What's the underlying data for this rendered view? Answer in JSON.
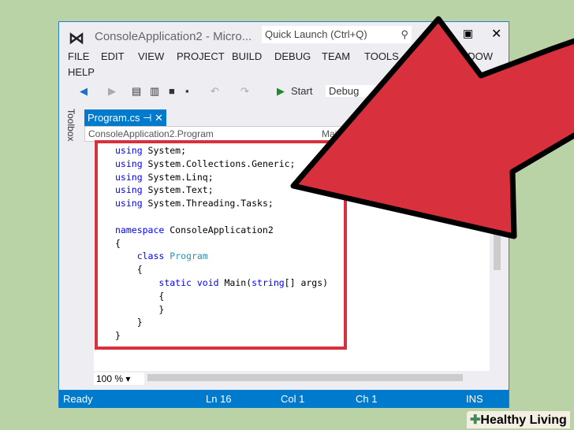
{
  "window": {
    "title": "ConsoleApplication2 - Micro...",
    "quick_launch": "Quick Launch (Ctrl+Q)"
  },
  "menu": [
    "FILE",
    "EDIT",
    "VIEW",
    "PROJECT",
    "BUILD",
    "DEBUG",
    "TEAM",
    "TOOLS",
    "WINDOW",
    "HELP"
  ],
  "toolbar": {
    "start": "Start",
    "config": "Debug"
  },
  "toolbox": "Toolbox",
  "tab": {
    "label": "Program.cs"
  },
  "nav": {
    "class": "ConsoleApplication2.Program",
    "member": "Main"
  },
  "code": [
    "using System;",
    "using System.Collections.Generic;",
    "using System.Linq;",
    "using System.Text;",
    "using System.Threading.Tasks;",
    "",
    "namespace ConsoleApplication2",
    "{",
    "    class Program",
    "    {",
    "        static void Main(string[] args)",
    "        {",
    "        }",
    "    }",
    "}"
  ],
  "zoom": "100 %",
  "status": {
    "ready": "Ready",
    "ln": "Ln 16",
    "col": "Col 1",
    "ch": "Ch 1",
    "ins": "INS"
  },
  "watermark": "Healthy Living",
  "colors": {
    "accent": "#007acc",
    "arrow": "#d9303e",
    "background": "#b9d2a6"
  }
}
